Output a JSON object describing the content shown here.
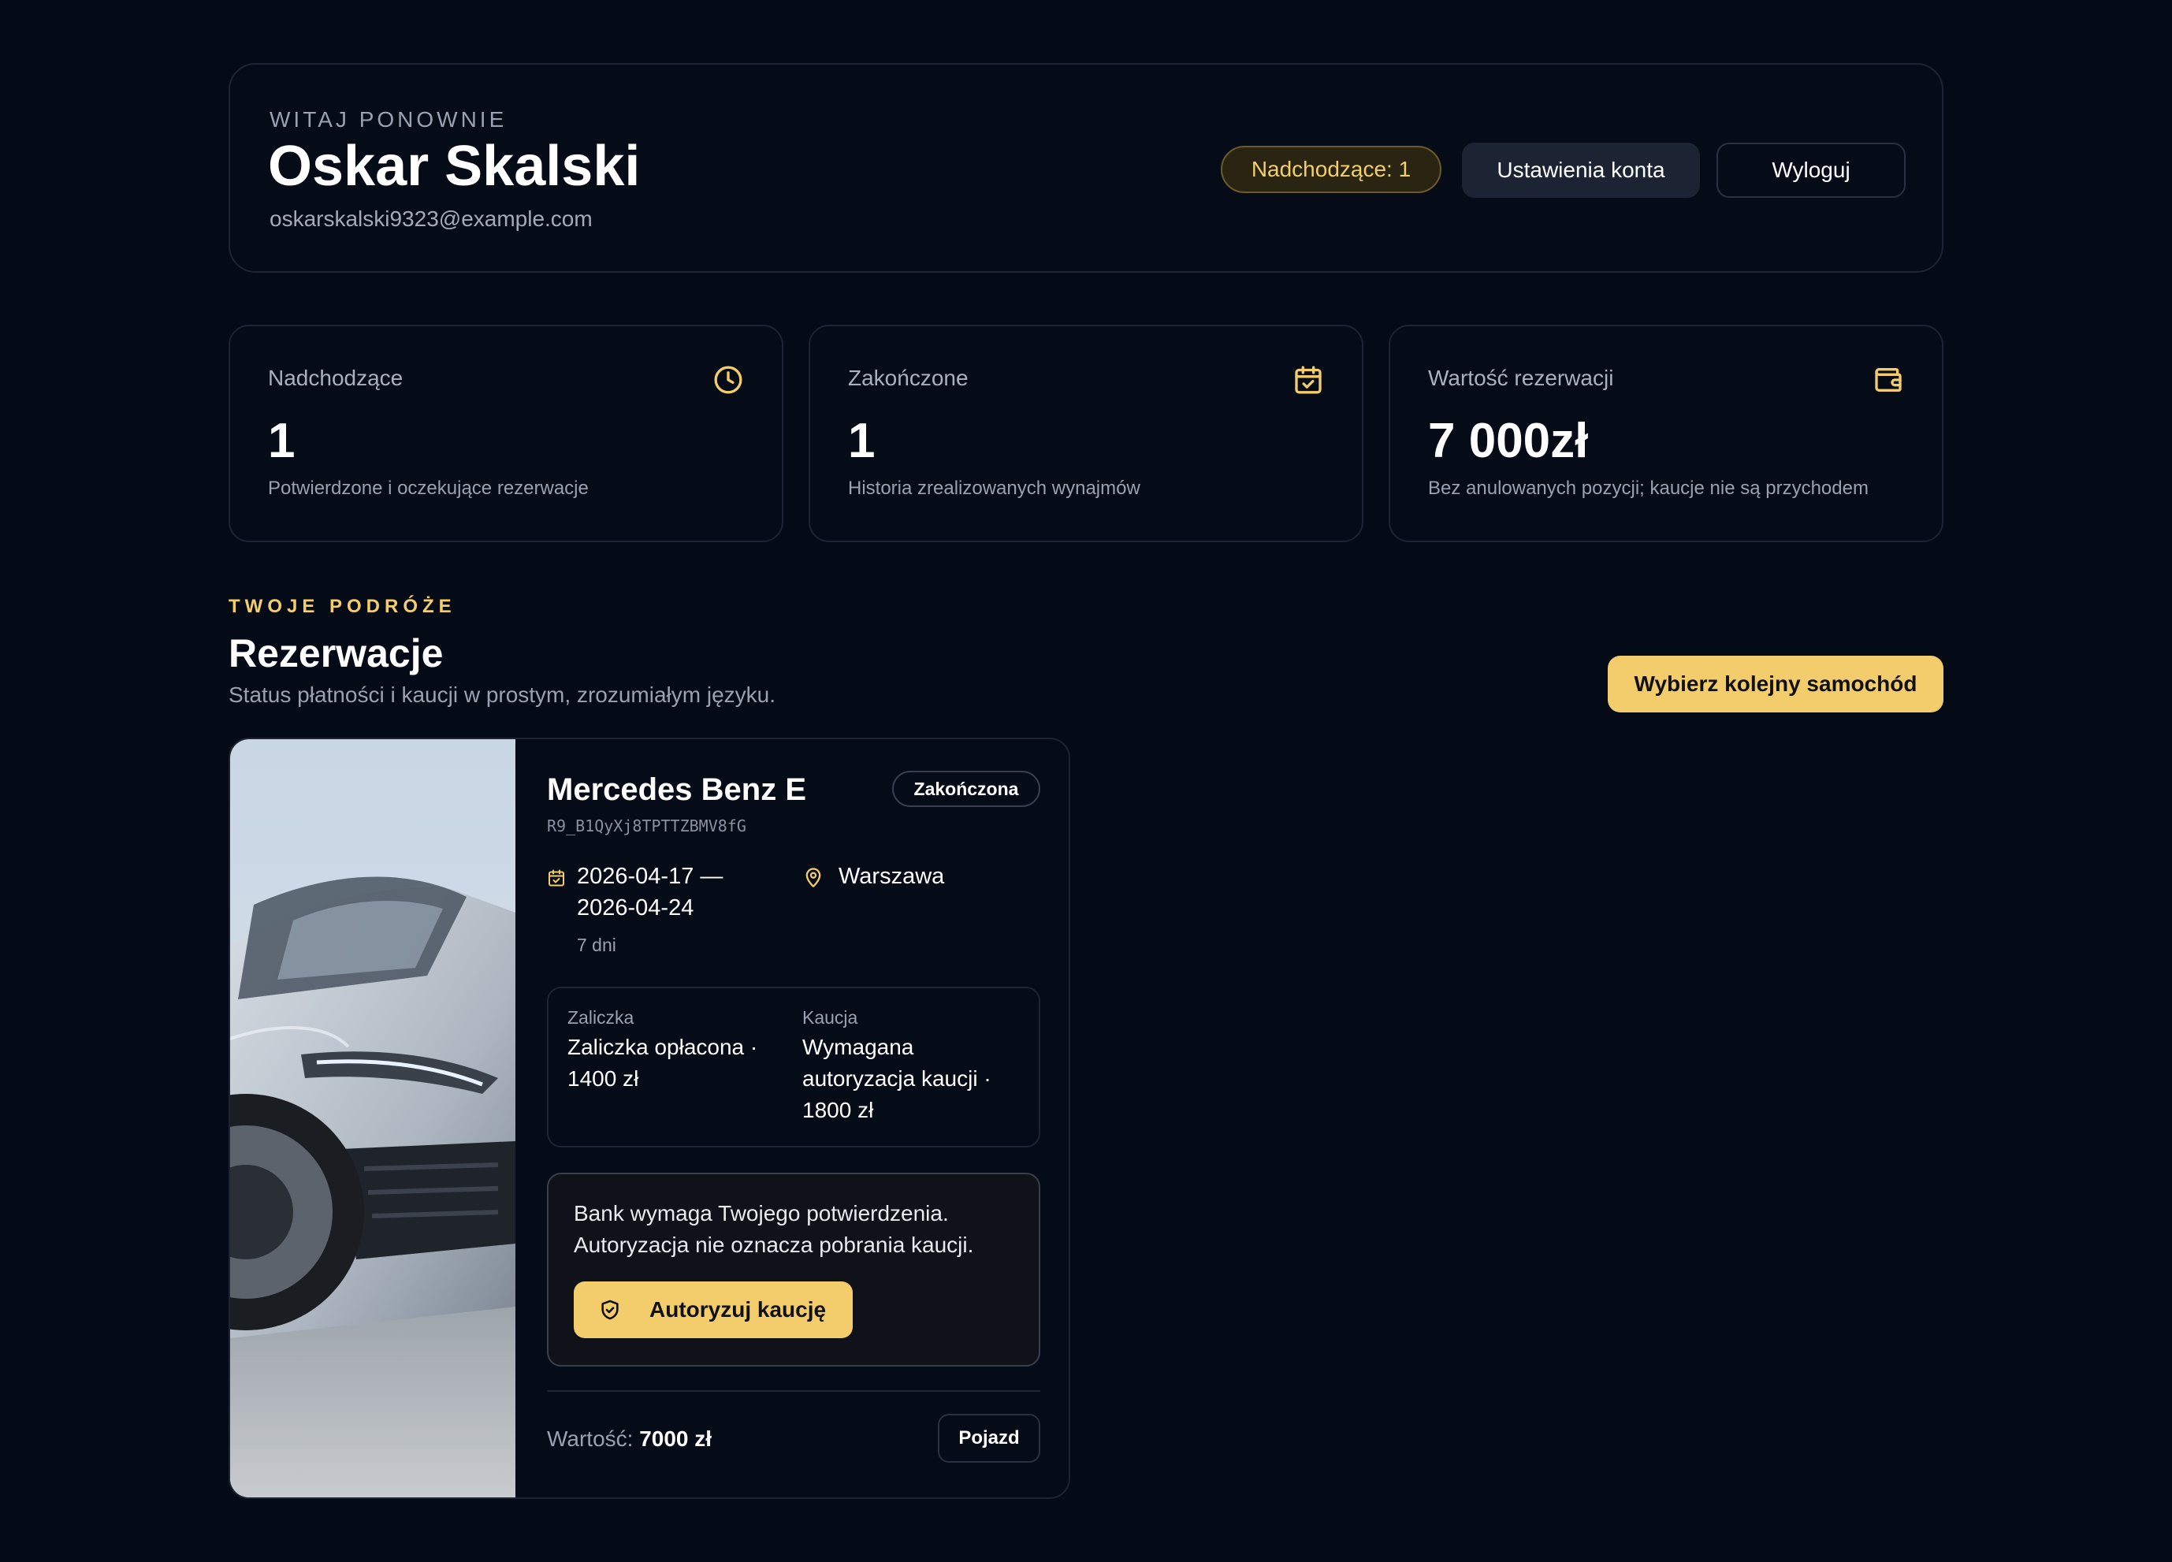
{
  "header": {
    "greeting": "WITAJ PONOWNIE",
    "user_name": "Oskar Skalski",
    "email": "oskarskalski9323@example.com",
    "upcoming_pill": "Nadchodzące: 1",
    "settings_button": "Ustawienia konta",
    "logout_button": "Wyloguj"
  },
  "stats": [
    {
      "label": "Nadchodzące",
      "value": "1",
      "description": "Potwierdzone i oczekujące rezerwacje",
      "icon": "clock-icon"
    },
    {
      "label": "Zakończone",
      "value": "1",
      "description": "Historia zrealizowanych wynajmów",
      "icon": "calendar-check-icon"
    },
    {
      "label": "Wartość rezerwacji",
      "value": "7 000zł",
      "description": "Bez anulowanych pozycji; kaucje nie są przychodem",
      "icon": "wallet-icon"
    }
  ],
  "section": {
    "eyebrow": "TWOJE PODRÓŻE",
    "title": "Rezerwacje",
    "subtitle": "Status płatności i kaucji w prostym, zrozumiałym języku.",
    "choose_button": "Wybierz kolejny samochód"
  },
  "booking": {
    "car_name": "Mercedes Benz E",
    "code": "R9_B1QyXj8TPTTZBMV8fG",
    "status": "Zakończona",
    "date_range": "2026-04-17 — 2026-04-24",
    "days": "7 dni",
    "location": "Warszawa",
    "deposit_label": "Zaliczka",
    "deposit_value": "Zaliczka opłacona · 1400 zł",
    "security_label": "Kaucja",
    "security_value": "Wymagana autoryzacja kaucji · 1800 zł",
    "bank_message": "Bank wymaga Twojego potwierdzenia. Autoryzacja nie oznacza pobrania kaucji.",
    "authorize_button": "Autoryzuj kaucję",
    "value_label": "Wartość:",
    "value_amount": "7000 zł",
    "vehicle_button": "Pojazd"
  },
  "colors": {
    "background": "#050a17",
    "accent": "#f3cd6c",
    "card_border": "#1e2433"
  }
}
